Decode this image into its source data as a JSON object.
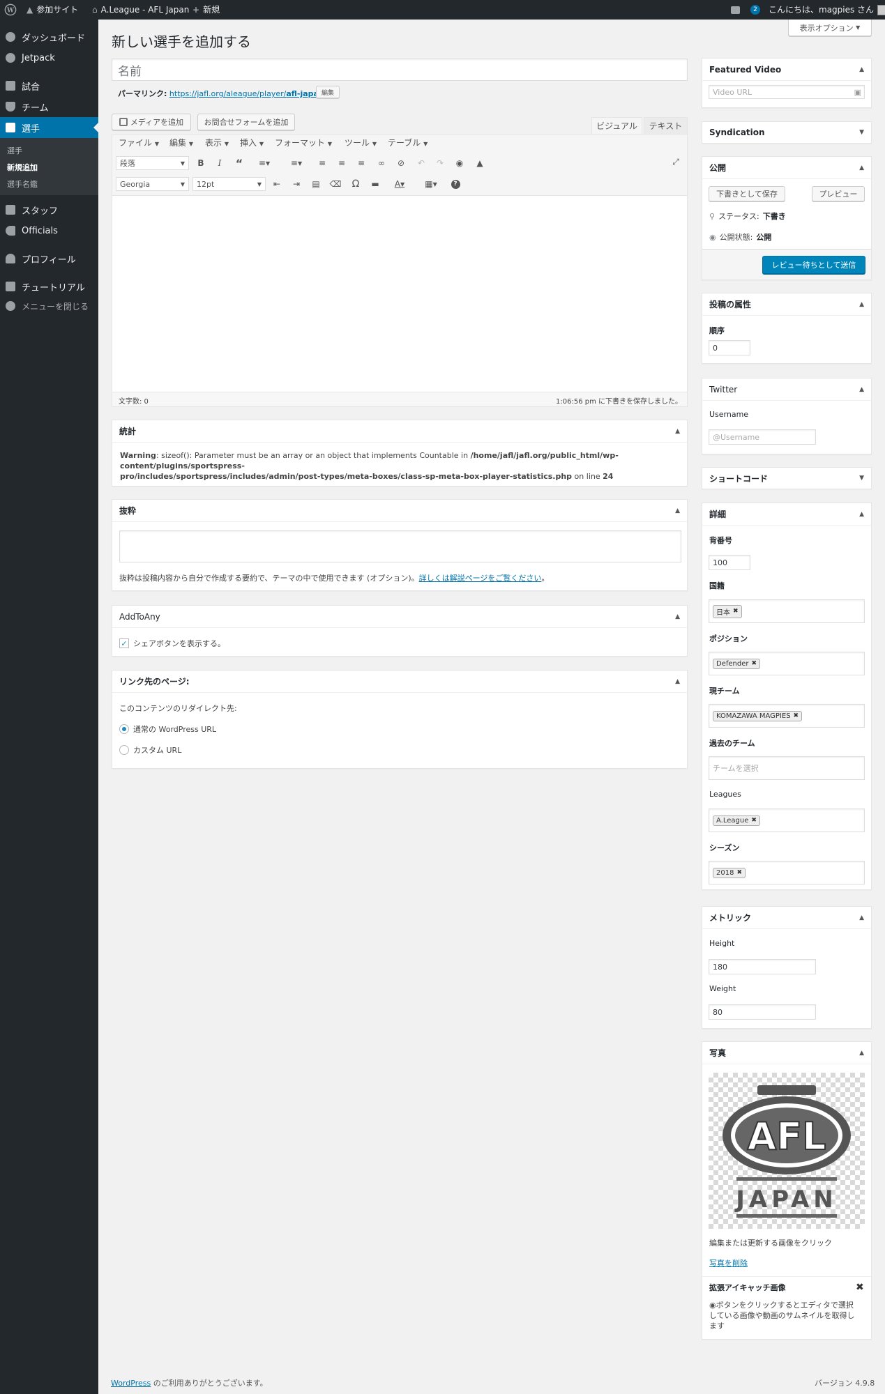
{
  "adminbar": {
    "site_name": "参加サイト",
    "site_title": "A.League - AFL Japan",
    "new_label": "新規",
    "comment_count": "2",
    "greeting": "こんにちは、magpies さん"
  },
  "menu": {
    "items": [
      {
        "label": "ダッシュボード",
        "icon": "dashboard-icon"
      },
      {
        "label": "Jetpack",
        "icon": "jetpack-icon"
      },
      {
        "label": "試合",
        "icon": "calendar-icon"
      },
      {
        "label": "チーム",
        "icon": "shield-icon"
      },
      {
        "label": "選手",
        "icon": "shirt-icon"
      },
      {
        "label": "スタッフ",
        "icon": "staff-icon"
      },
      {
        "label": "Officials",
        "icon": "whistle-icon"
      },
      {
        "label": "プロフィール",
        "icon": "user-icon"
      },
      {
        "label": "チュートリアル",
        "icon": "tutorial-icon"
      },
      {
        "label": "メニューを閉じる",
        "icon": "collapse-icon"
      }
    ],
    "submenu": [
      "選手",
      "新規追加",
      "選手名鑑"
    ]
  },
  "screen_options": "表示オプション",
  "page_title": "新しい選手を追加する",
  "title_placeholder": "名前",
  "permalink": {
    "label": "パーマリンク:",
    "url_prefix": "https://jafl.org/aleague/player/",
    "slug": "afl-japan",
    "url_suffix": "/",
    "edit_label": "編集"
  },
  "editor": {
    "add_media": "メディアを追加",
    "add_form": "お問合せフォームを追加",
    "tab_visual": "ビジュアル",
    "tab_text": "テキスト",
    "menubar": [
      "ファイル",
      "編集",
      "表示",
      "挿入",
      "フォーマット",
      "ツール",
      "テーブル"
    ],
    "format_select": "段落",
    "font_select": "Georgia",
    "size_select": "12pt",
    "word_count": "文字数: 0",
    "autosave": "1:06:56 pm に下書きを保存しました。"
  },
  "stats_box": {
    "title": "統計",
    "warning_label": "Warning",
    "warning_text": ": sizeof(): Parameter must be an array or an object that implements Countable in ",
    "warning_path_1": "/home/jafl/jafl.org/public_html/wp-content/plugins/sportspress-",
    "warning_path_2": "pro/includes/sportspress/includes/admin/post-types/meta-boxes/class-sp-meta-box-player-statistics.php",
    "warning_on_line": " on line ",
    "warning_line": "24"
  },
  "excerpt_box": {
    "title": "抜粋",
    "help": "抜粋は投稿内容から自分で作成する要約で、テーマの中で使用できます (オプション)。",
    "link": "詳しくは解説ページをご覧ください",
    "after": "。"
  },
  "addtoany_box": {
    "title": "AddToAny",
    "checkbox_label": "シェアボタンを表示する。"
  },
  "link_box": {
    "title": "リンク先のページ:",
    "desc": "このコンテンツのリダイレクト先:",
    "option_1": "通常の WordPress URL",
    "option_2": "カスタム URL"
  },
  "sidebar": {
    "featured_video": {
      "title": "Featured Video",
      "placeholder": "Video URL"
    },
    "syndication": {
      "title": "Syndication"
    },
    "publish": {
      "title": "公開",
      "save_draft": "下書きとして保存",
      "preview": "プレビュー",
      "status_label": "ステータス:",
      "status_value": "下書き",
      "visibility_label": "公開状態:",
      "visibility_value": "公開",
      "submit": "レビュー待ちとして送信"
    },
    "attributes": {
      "title": "投稿の属性",
      "order_label": "順序",
      "order_value": "0"
    },
    "twitter": {
      "title": "Twitter",
      "username_label": "Username",
      "username_placeholder": "@Username"
    },
    "shortcode": {
      "title": "ショートコード"
    },
    "details": {
      "title": "詳細",
      "number_label": "背番号",
      "number_value": "100",
      "nationality_label": "国籍",
      "nationality_value": "日本",
      "position_label": "ポジション",
      "position_value": "Defender",
      "current_team_label": "現チーム",
      "current_team_value": "KOMAZAWA MAGPIES",
      "past_team_label": "過去のチーム",
      "past_team_placeholder": "チームを選択",
      "leagues_label": "Leagues",
      "leagues_value": "A.League",
      "season_label": "シーズン",
      "season_value": "2018"
    },
    "metrics": {
      "title": "メトリック",
      "height_label": "Height",
      "height_value": "180",
      "weight_label": "Weight",
      "weight_value": "80"
    },
    "photo": {
      "title": "写真",
      "logo_top": "AFL",
      "logo_bottom": "JAPAN",
      "hint": "編集または更新する画像をクリック",
      "remove": "写真を削除",
      "ext_title": "拡張アイキャッチ画像",
      "ext_desc_1": "ボタンをクリックするとエディタで選択",
      "ext_desc_2": "している画像や動画のサムネイルを取得し",
      "ext_desc_3": "ます"
    }
  },
  "footer": {
    "wp_link": "WordPress",
    "thanks": " のご利用ありがとうございます。",
    "version": "バージョン 4.9.8"
  },
  "colors": {
    "accent": "#0073aa",
    "menu_bg": "#23282d",
    "primary_button": "#0085ba"
  }
}
